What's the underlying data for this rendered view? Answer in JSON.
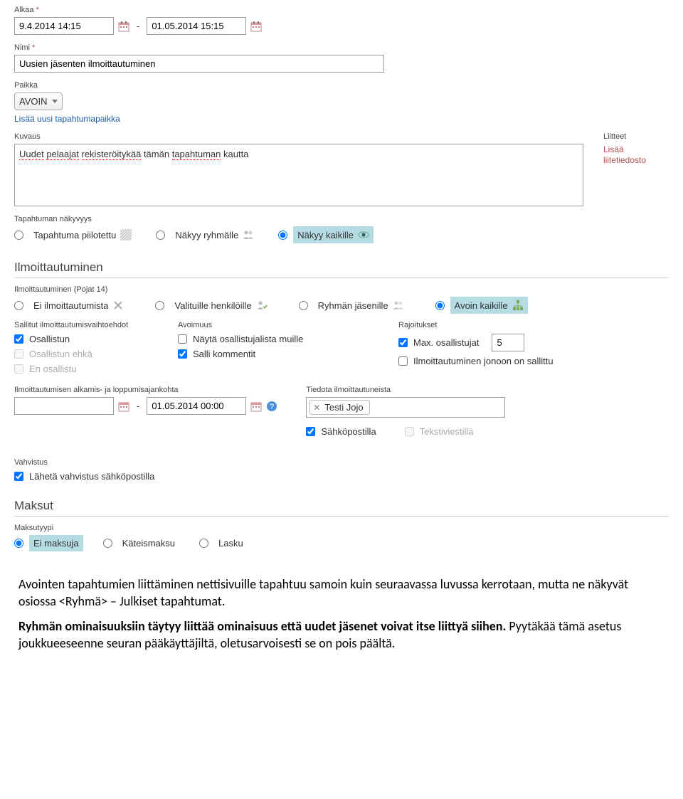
{
  "labels": {
    "alkaa": "Alkaa",
    "nimi": "Nimi",
    "paikka": "Paikka",
    "kuvaus": "Kuvaus",
    "liitteet": "Liitteet",
    "add_place": "Lisää uusi tapahtumapaikka",
    "add_file": "Lisää liitetiedosto",
    "visibility": "Tapahtuman näkyvyys",
    "ilmoittautuminen": "Ilmoittautuminen",
    "ilmo_group": "Ilmoittautuminen (Pojat 14)",
    "allowed": "Sallitut ilmoittautumisvaihtoehdot",
    "openness": "Avoimuus",
    "restrictions": "Rajoitukset",
    "reg_time": "Ilmoittautumisen alkamis- ja loppumisajankohta",
    "notify": "Tiedota ilmoittautuneista",
    "confirmation": "Vahvistus",
    "maksut": "Maksut",
    "maksutyypi": "Maksutyypi"
  },
  "values": {
    "start_date": "9.4.2014 14:15",
    "end_date": "01.05.2014 15:15",
    "name": "Uusien jäsenten ilmoittautuminen",
    "place": "AVOIN",
    "description_parts": [
      "Uudet",
      "pelaajat",
      "rekisteröitykää",
      "tämän",
      "tapahtuman",
      "kautta"
    ],
    "reg_start": "",
    "reg_end": "01.05.2014 00:00",
    "max_participants": "5",
    "token_name": "Testi Jojo"
  },
  "visibility": [
    {
      "label": "Tapahtuma piilotettu",
      "checked": false
    },
    {
      "label": "Näkyy ryhmälle",
      "checked": false
    },
    {
      "label": "Näkyy kaikille",
      "checked": true
    }
  ],
  "registration_scope": [
    {
      "label": "Ei ilmoittautumista",
      "checked": false
    },
    {
      "label": "Valituille henkilöille",
      "checked": false
    },
    {
      "label": "Ryhmän jäsenille",
      "checked": false
    },
    {
      "label": "Avoin kaikille",
      "checked": true
    }
  ],
  "allowed_opts": [
    {
      "label": "Osallistun",
      "checked": true,
      "disabled": false
    },
    {
      "label": "Osallistun ehkä",
      "checked": false,
      "disabled": true
    },
    {
      "label": "En osallistu",
      "checked": false,
      "disabled": true
    }
  ],
  "openness_opts": [
    {
      "label": "Näytä osallistujalista muille",
      "checked": false
    },
    {
      "label": "Salli kommentit",
      "checked": true
    }
  ],
  "restriction_opts": {
    "max_label": "Max. osallistujat",
    "max_checked": true,
    "queue_label": "Ilmoittautuminen jonoon on sallittu",
    "queue_checked": false
  },
  "notify_opts": {
    "email": "Sähköpostilla",
    "email_checked": true,
    "sms": "Tekstiviestillä",
    "sms_checked": false,
    "sms_disabled": true
  },
  "confirm_opt": {
    "label": "Lähetä vahvistus sähköpostilla",
    "checked": true
  },
  "payment_types": [
    {
      "label": "Ei maksuja",
      "checked": true
    },
    {
      "label": "Käteismaksu",
      "checked": false
    },
    {
      "label": "Lasku",
      "checked": false
    }
  ],
  "bottom_text": {
    "p1": "Avointen tapahtumien liittäminen nettisivuille tapahtuu samoin kuin seuraavassa luvussa kerrotaan, mutta ne näkyvät osiossa <Ryhmä> – Julkiset tapahtumat.",
    "p2a": "Ryhmän ominaisuuksiin täytyy liittää ominaisuus että uudet jäsenet voivat itse liittyä siihen.",
    "p2b": " Pyytäkää tämä asetus joukkueeseenne seuran pääkäyttäjiltä, oletusarvoisesti se on pois päältä."
  }
}
